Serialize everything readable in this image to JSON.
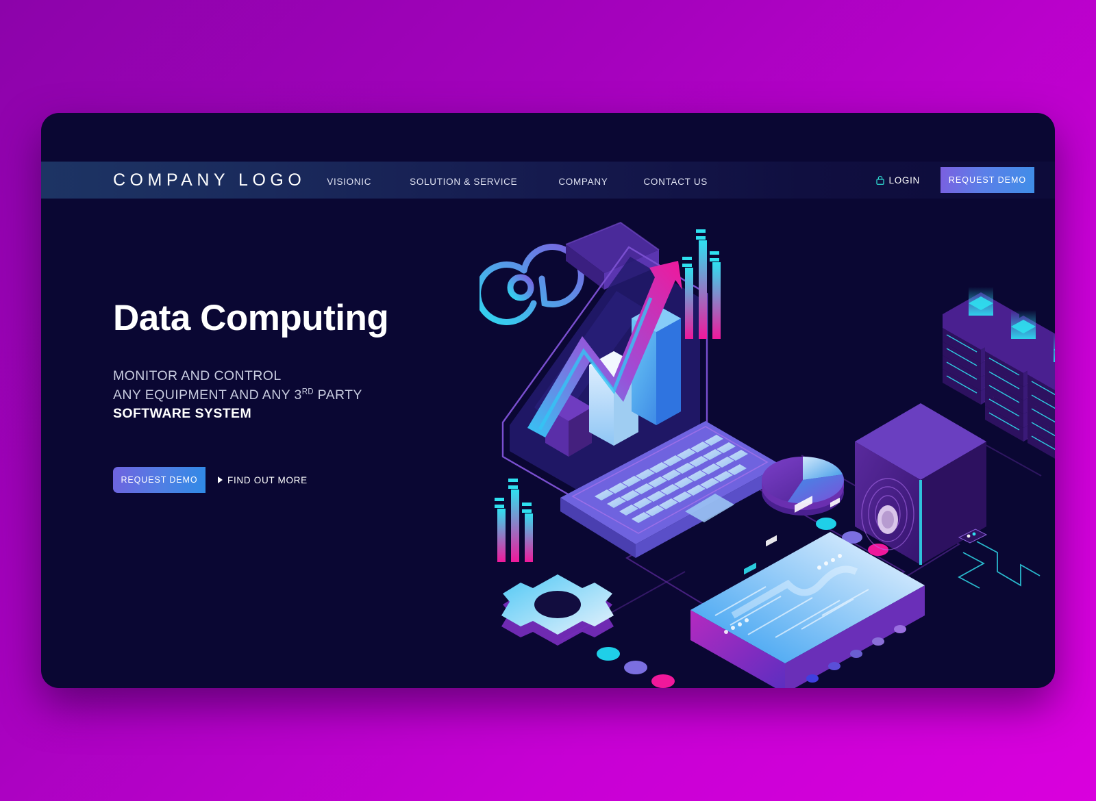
{
  "theme": {
    "page_bg_start": "#8c03aa",
    "page_bg_end": "#d900dd",
    "card_bg": "#0a0733",
    "accent_blue": "#3f8ee8",
    "accent_purple": "#7b5fe0",
    "accent_cyan": "#22d7ee",
    "accent_magenta": "#f0189b"
  },
  "header": {
    "logo": "COMPANY LOGO",
    "nav": [
      {
        "label": "VISIONIC"
      },
      {
        "label": "SOLUTION & SERVICE"
      },
      {
        "label": "COMPANY"
      },
      {
        "label": "CONTACT US"
      }
    ],
    "login_label": "LOGIN",
    "login_icon": "lock-icon",
    "demo_button": "REQUEST DEMO"
  },
  "hero": {
    "headline": "Data Computing",
    "sub_line1": "MONITOR AND CONTROL",
    "sub_line2_a": "ANY EQUIPMENT AND ANY 3",
    "sub_line2_sup": "RD",
    "sub_line2_b": " PARTY",
    "sub_line3": "SOFTWARE SYSTEM",
    "cta_primary": "REQUEST DEMO",
    "cta_secondary": "FIND OUT MORE",
    "cta_secondary_icon": "play-triangle-icon"
  },
  "illustration": {
    "name": "isometric-data-computing-scene",
    "elements": [
      "at-symbol-icon",
      "envelope-icon",
      "growth-arrow-icon",
      "laptop-icon",
      "bar-chart-3d",
      "equalizer-bars",
      "gear-icon",
      "pie-chart-3d",
      "vault-icon",
      "server-racks-icon",
      "tablet-icon"
    ]
  }
}
